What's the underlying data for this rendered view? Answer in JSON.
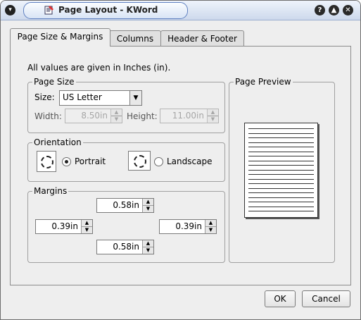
{
  "window": {
    "title": "Page Layout - KWord",
    "buttons": {
      "help": "?",
      "maximize": "▲",
      "close": "✕",
      "menu": "▾"
    }
  },
  "tabs": [
    {
      "label": "Page Size & Margins",
      "accel": "M",
      "active": true
    },
    {
      "label": "Columns",
      "accel": "o",
      "active": false
    },
    {
      "label": "Header & Footer",
      "accel": "e",
      "active": false
    }
  ],
  "info_text": "All values are given in Inches (in).",
  "page_size": {
    "legend": "Page Size",
    "size_label": "Size:",
    "size_value": "US Letter",
    "width_label": "Width:",
    "width_value": "8.50in",
    "height_label": "Height:",
    "height_value": "11.00in"
  },
  "orientation": {
    "legend": "Orientation",
    "portrait_label": "Portrait",
    "landscape_label": "Landscape",
    "selected": "portrait"
  },
  "margins": {
    "legend": "Margins",
    "top": "0.58in",
    "left": "0.39in",
    "right": "0.39in",
    "bottom": "0.58in"
  },
  "preview": {
    "legend": "Page Preview"
  },
  "footer": {
    "ok_label": "OK",
    "cancel_label": "Cancel"
  }
}
